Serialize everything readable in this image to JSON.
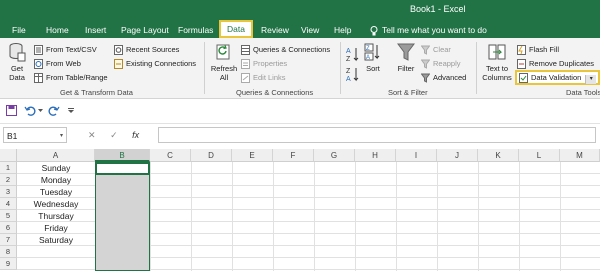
{
  "window": {
    "title": "Book1 - Excel"
  },
  "tabs": [
    {
      "label": "File"
    },
    {
      "label": "Home"
    },
    {
      "label": "Insert"
    },
    {
      "label": "Page Layout"
    },
    {
      "label": "Formulas"
    },
    {
      "label": "Data"
    },
    {
      "label": "Review"
    },
    {
      "label": "View"
    },
    {
      "label": "Help"
    }
  ],
  "tell_me": "Tell me what you want to do",
  "ribbon": {
    "get_transform": {
      "get_data": "Get\nData",
      "from_text_csv": "From Text/CSV",
      "from_web": "From Web",
      "from_table_range": "From Table/Range",
      "recent_sources": "Recent Sources",
      "existing_connections": "Existing Connections",
      "label": "Get & Transform Data"
    },
    "queries": {
      "refresh_all": "Refresh\nAll",
      "queries_connections": "Queries & Connections",
      "properties": "Properties",
      "edit_links": "Edit Links",
      "label": "Queries & Connections"
    },
    "sort_filter": {
      "sort": "Sort",
      "filter": "Filter",
      "clear": "Clear",
      "reapply": "Reapply",
      "advanced": "Advanced",
      "label": "Sort & Filter"
    },
    "data_tools": {
      "text_to_columns": "Text to\nColumns",
      "flash_fill": "Flash Fill",
      "remove_duplicates": "Remove Duplicates",
      "data_validation": "Data Validation",
      "label": "Data Tools"
    }
  },
  "formula_bar": {
    "name_box": "B1",
    "cancel": "✕",
    "enter": "✓",
    "fx": "fx",
    "value": ""
  },
  "columns": [
    "A",
    "B",
    "C",
    "D",
    "E",
    "F",
    "G",
    "H",
    "I",
    "J",
    "K",
    "L",
    "M"
  ],
  "rows": [
    "1",
    "2",
    "3",
    "4",
    "5",
    "6",
    "7",
    "8",
    "9"
  ],
  "column_a": [
    "Sunday",
    "Monday",
    "Tuesday",
    "Wednesday",
    "Thursday",
    "Friday",
    "Saturday",
    "",
    ""
  ],
  "colors": {
    "accent": "#217346",
    "highlight": "#e8c53a"
  }
}
